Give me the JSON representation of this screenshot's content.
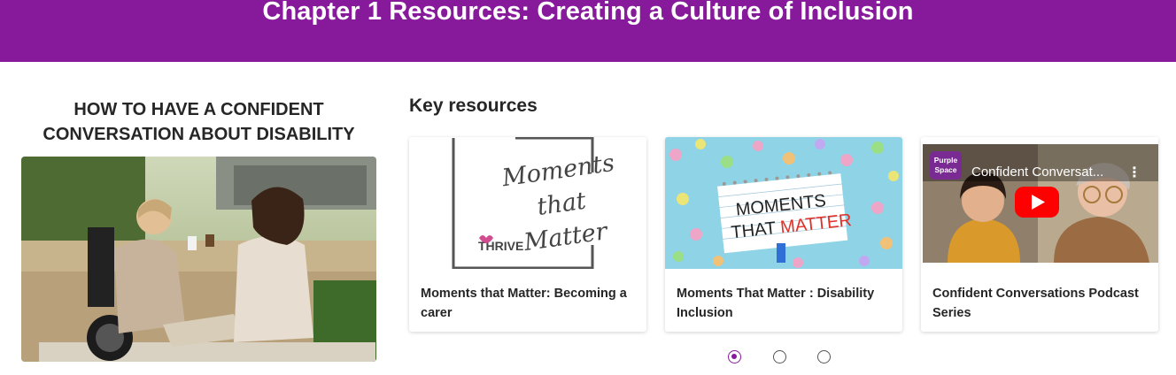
{
  "banner": {
    "title": "Chapter 1 Resources: Creating a Culture of Inclusion",
    "color": "#861a9b"
  },
  "feature": {
    "heading_line1": "HOW TO HAVE A CONFIDENT",
    "heading_line2": "CONVERSATION ABOUT DISABILITY",
    "image": "photo-two-women-talking-outdoors-one-in-wheelchair"
  },
  "key_resources": {
    "heading": "Key resources",
    "cards": [
      {
        "title": "Moments that Matter: Becoming a carer",
        "thumb_text_line1": "Moments",
        "thumb_text_line2": "that",
        "thumb_text_line3": "Matter",
        "thumb_logo": "THRIVE"
      },
      {
        "title": "Moments That Matter : Disability Inclusion",
        "thumb_text_line1": "MOMENTS",
        "thumb_text_line2a": "THAT ",
        "thumb_text_line2b": "MATTER"
      },
      {
        "title": "Confident Conversations Podcast Series",
        "video_title": "Confident Conversat...",
        "channel_badge_line1": "Purple",
        "channel_badge_line2": "Space",
        "menu_glyph": "⋮"
      }
    ]
  },
  "pagination": {
    "total": 3,
    "current": 1
  },
  "icons": {
    "play": "play-icon",
    "more": "more-vert-icon"
  }
}
